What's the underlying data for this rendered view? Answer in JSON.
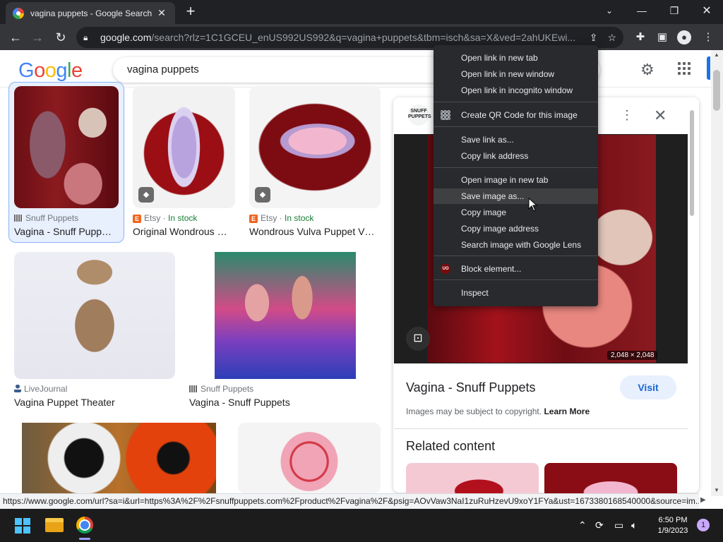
{
  "browser": {
    "tab_title": "vagina puppets - Google Search",
    "tab_close_glyph": "✕",
    "new_tab_glyph": "+",
    "url_domain": "google.com",
    "url_path": "/search?rlz=1C1GCEU_enUS992US992&q=vagina+puppets&tbm=isch&sa=X&ved=2ahUKEwi...",
    "window_controls": {
      "dropdown": "⌄",
      "minimize": "—",
      "maximize": "❐",
      "close": "✕"
    }
  },
  "google": {
    "logo_letters": [
      "G",
      "o",
      "o",
      "g",
      "l",
      "e"
    ],
    "logo_colors": [
      "#4285f4",
      "#ea4335",
      "#fbbc05",
      "#4285f4",
      "#34a853",
      "#ea4335"
    ],
    "search_query": "vagina puppets"
  },
  "results": [
    {
      "source": "Snuff Puppets",
      "title": "Vagina - Snuff Pupp…",
      "stock": ""
    },
    {
      "source": "Etsy",
      "title": "Original Wondrous …",
      "stock": "In stock"
    },
    {
      "source": "Etsy",
      "title": "Wondrous Vulva Puppet V…",
      "stock": "In stock"
    },
    {
      "source": "LiveJournal",
      "title": "Vagina Puppet Theater",
      "stock": ""
    },
    {
      "source": "Snuff Puppets",
      "title": "Vagina - Snuff Puppets",
      "stock": ""
    }
  ],
  "source_separator": " · ",
  "etsy_badge": "E",
  "panel": {
    "logo_text": "SNUFF PUPPETS",
    "dimensions": "2,048 × 2,048",
    "title": "Vagina - Snuff Puppets",
    "visit_label": "Visit",
    "copyright_text": "Images may be subject to copyright.",
    "learn_more": "Learn More",
    "related_heading": "Related content"
  },
  "context_menu": {
    "items": [
      "Open link in new tab",
      "Open link in new window",
      "Open link in incognito window",
      "Create QR Code for this image",
      "Save link as...",
      "Copy link address",
      "Open image in new tab",
      "Save image as...",
      "Copy image",
      "Copy image address",
      "Search image with Google Lens",
      "Block element...",
      "Inspect"
    ],
    "hovered_item": "Save image as...",
    "ublock_badge": "UO"
  },
  "status_url": "https://www.google.com/url?sa=i&url=https%3A%2F%2Fsnuffpuppets.com%2Fproduct%2Fvagina%2F&psig=AOvVaw3NaI1zuRuHzevU9xoY1FYa&ust=1673380168540000&source=im...",
  "taskbar": {
    "time": "6:50 PM",
    "date": "1/9/2023",
    "notification_count": "1"
  }
}
